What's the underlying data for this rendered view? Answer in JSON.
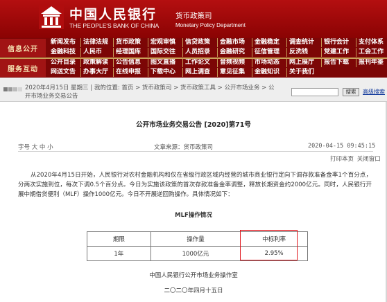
{
  "header": {
    "bank_name_cn": "中国人民银行",
    "bank_name_en": "THE PEOPLE'S BANK OF CHINA",
    "dept_name_cn": "货币政策司",
    "dept_name_en": "Monetary Policy Department",
    "bg_color": "#a20b0b"
  },
  "nav": {
    "info_label": "信息公开",
    "service_label": "服务互动",
    "row1": [
      "新闻发布",
      "法律法规",
      "货币政策",
      "宏观审慎",
      "信贷政策",
      "金融市场",
      "金融稳定",
      "调查统计",
      "银行会计",
      "支付体系"
    ],
    "row2": [
      "金融科技",
      "人民币",
      "经理国库",
      "国际交往",
      "人员招录",
      "金融研究",
      "征信管理",
      "反洗钱",
      "党建工作",
      "工会工作"
    ],
    "row3": [
      "公开目录",
      "政策解读",
      "公告信息",
      "图文直播",
      "工作论文",
      "音频视频",
      "市场动态",
      "网上展厅",
      "报告下载",
      "报刊年鉴"
    ],
    "row4": [
      "网送文告",
      "办事大厅",
      "在线申报",
      "下载中心",
      "网上调查",
      "意见征集",
      "金融知识",
      "关于我们"
    ]
  },
  "breadcrumb": {
    "text": "2020年4月15日 星期三 | 我的位置: 首页 > 货币政策司 > 货币政策工具 > 公开市场业务 > 公开市场业务交易公告",
    "search_placeholder": "",
    "search_button": "搜索",
    "advanced_search": "高级搜索"
  },
  "article": {
    "title": "公开市场业务交易公告 [2020]第71号",
    "font_size_label": "字号 大 中 小",
    "source": "文章来源：货币政策司",
    "time": "2020-04-15 09:45:15",
    "print_label": "打印本页",
    "close_label": "关闭窗口",
    "body": "从2020年4月15日开始，人民银行对农村金融机构和仅在省级行政区域内经营的城市商业银行定向下调存款准备金率1个百分点，分两次实施到位，每次下调0.5个百分点。今日为实施该政策的首次存款准备金率调整，释放长期资金约2000亿元。同时，人民银行开展中期借贷便利（MLF）操作1000亿元。今日不开展逆回购操作。具体情况如下：",
    "table_title": "MLF操作情况",
    "table": {
      "headers": [
        "期限",
        "操作量",
        "中标利率"
      ],
      "rows": [
        [
          "1年",
          "1000亿元",
          "2.95%"
        ]
      ]
    },
    "signature_org": "中国人民银行公开市场业务操作室",
    "signature_date": "二〇二〇年四月十五日",
    "highlight_color": "#e0141b"
  }
}
